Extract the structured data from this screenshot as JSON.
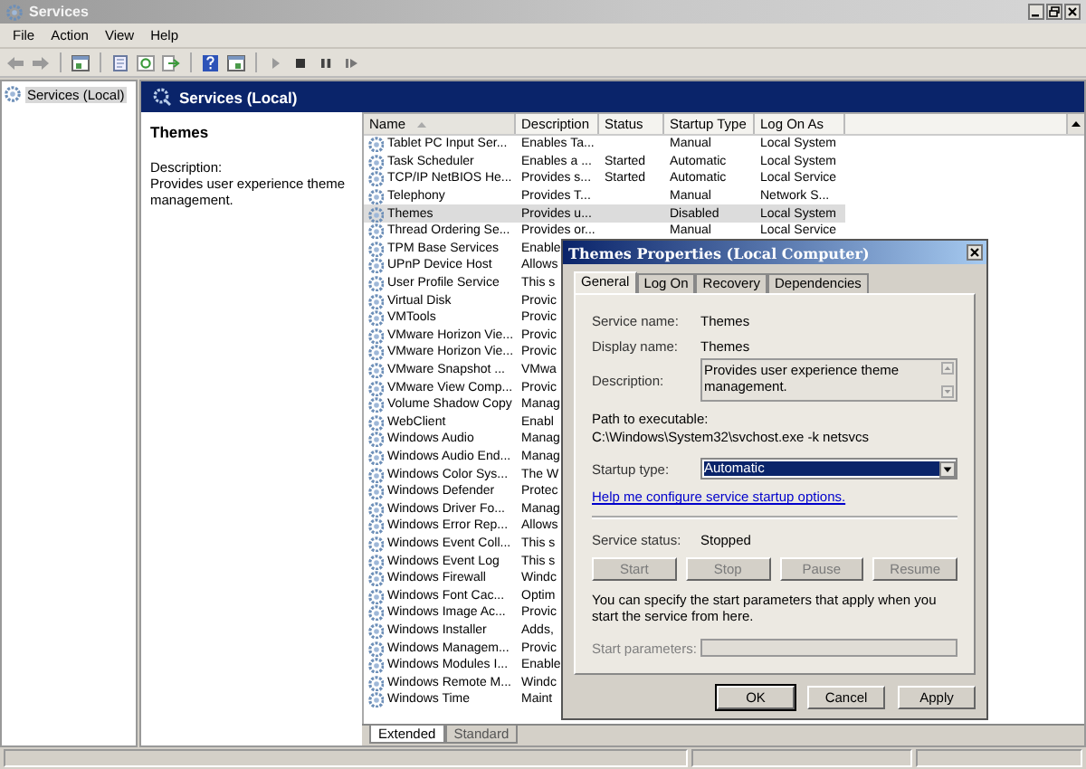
{
  "window": {
    "title": "Services"
  },
  "menu": [
    {
      "label": "File"
    },
    {
      "label": "Action"
    },
    {
      "label": "View"
    },
    {
      "label": "Help"
    }
  ],
  "tree": [
    {
      "label": "Services (Local)",
      "selected": true
    }
  ],
  "pane_header": "Services (Local)",
  "detail": {
    "title": "Themes",
    "description_label": "Description:",
    "description": "Provides user experience theme management."
  },
  "table": {
    "columns": [
      {
        "label": "Name",
        "sorted": true
      },
      {
        "label": "Description",
        "sorted": false
      },
      {
        "label": "Status",
        "sorted": false
      },
      {
        "label": "Startup Type",
        "sorted": false
      },
      {
        "label": "Log On As",
        "sorted": false
      }
    ],
    "rows": [
      {
        "cells": [
          "Tablet PC Input Ser...",
          "Enables Ta...",
          "",
          "Manual",
          "Local System"
        ],
        "selected": false
      },
      {
        "cells": [
          "Task Scheduler",
          "Enables a ...",
          "Started",
          "Automatic",
          "Local System"
        ],
        "selected": false
      },
      {
        "cells": [
          "TCP/IP NetBIOS He...",
          "Provides s...",
          "Started",
          "Automatic",
          "Local Service"
        ],
        "selected": false
      },
      {
        "cells": [
          "Telephony",
          "Provides T...",
          "",
          "Manual",
          "Network S..."
        ],
        "selected": false
      },
      {
        "cells": [
          "Themes",
          "Provides u...",
          "",
          "Disabled",
          "Local System"
        ],
        "selected": true
      },
      {
        "cells": [
          "Thread Ordering Se...",
          "Provides or...",
          "",
          "Manual",
          "Local Service"
        ],
        "selected": false
      },
      {
        "cells": [
          "TPM Base Services",
          "Enable"
        ],
        "selected": false
      },
      {
        "cells": [
          "UPnP Device Host",
          "Allows"
        ],
        "selected": false
      },
      {
        "cells": [
          "User Profile Service",
          "This s"
        ],
        "selected": false
      },
      {
        "cells": [
          "Virtual Disk",
          "Provic"
        ],
        "selected": false
      },
      {
        "cells": [
          "VMTools",
          "Provic"
        ],
        "selected": false
      },
      {
        "cells": [
          "VMware Horizon Vie...",
          "Provic"
        ],
        "selected": false
      },
      {
        "cells": [
          "VMware Horizon Vie...",
          "Provic"
        ],
        "selected": false
      },
      {
        "cells": [
          "VMware Snapshot ...",
          "VMwa"
        ],
        "selected": false
      },
      {
        "cells": [
          "VMware View Comp...",
          "Provic"
        ],
        "selected": false
      },
      {
        "cells": [
          "Volume Shadow Copy",
          "Manag"
        ],
        "selected": false
      },
      {
        "cells": [
          "WebClient",
          "Enabl"
        ],
        "selected": false
      },
      {
        "cells": [
          "Windows Audio",
          "Manag"
        ],
        "selected": false
      },
      {
        "cells": [
          "Windows Audio End...",
          "Manag"
        ],
        "selected": false
      },
      {
        "cells": [
          "Windows Color Sys...",
          "The W"
        ],
        "selected": false
      },
      {
        "cells": [
          "Windows Defender",
          "Protec"
        ],
        "selected": false
      },
      {
        "cells": [
          "Windows Driver Fo...",
          "Manag"
        ],
        "selected": false
      },
      {
        "cells": [
          "Windows Error Rep...",
          "Allows"
        ],
        "selected": false
      },
      {
        "cells": [
          "Windows Event Coll...",
          "This s"
        ],
        "selected": false
      },
      {
        "cells": [
          "Windows Event Log",
          "This s"
        ],
        "selected": false
      },
      {
        "cells": [
          "Windows Firewall",
          "Windc"
        ],
        "selected": false
      },
      {
        "cells": [
          "Windows Font Cac...",
          "Optim"
        ],
        "selected": false
      },
      {
        "cells": [
          "Windows Image Ac...",
          "Provic"
        ],
        "selected": false
      },
      {
        "cells": [
          "Windows Installer",
          "Adds,"
        ],
        "selected": false
      },
      {
        "cells": [
          "Windows Managem...",
          "Provic"
        ],
        "selected": false
      },
      {
        "cells": [
          "Windows Modules I...",
          "Enable"
        ],
        "selected": false
      },
      {
        "cells": [
          "Windows Remote M...",
          "Windc"
        ],
        "selected": false
      },
      {
        "cells": [
          "Windows Time",
          "Maint"
        ],
        "selected": false
      }
    ]
  },
  "view_tabs": [
    {
      "label": "Extended",
      "selected": true
    },
    {
      "label": "Standard",
      "selected": false
    }
  ],
  "dialog": {
    "title": "Themes Properties (Local Computer)",
    "tabs": [
      {
        "label": "General",
        "selected": true
      },
      {
        "label": "Log On",
        "selected": false
      },
      {
        "label": "Recovery",
        "selected": false
      },
      {
        "label": "Dependencies",
        "selected": false
      }
    ],
    "service_name_label": "Service name:",
    "service_name": "Themes",
    "display_name_label": "Display name:",
    "display_name": "Themes",
    "description_label": "Description:",
    "description": "Provides user experience theme management.",
    "path_label": "Path to executable:",
    "path": "C:\\Windows\\System32\\svchost.exe -k netsvcs",
    "startup_label": "Startup type:",
    "startup_value": "Automatic",
    "help_link": "Help me configure service startup options.",
    "status_label": "Service status:",
    "status_value": "Stopped",
    "control_buttons": [
      {
        "label": "Start",
        "disabled": true
      },
      {
        "label": "Stop",
        "disabled": true
      },
      {
        "label": "Pause",
        "disabled": true
      },
      {
        "label": "Resume",
        "disabled": true
      }
    ],
    "note": "You can specify the start parameters that apply when you start the service from here.",
    "params_label": "Start parameters:",
    "params_disabled": true,
    "buttons": [
      {
        "label": "OK",
        "default": true
      },
      {
        "label": "Cancel",
        "default": false
      },
      {
        "label": "Apply",
        "default": false
      }
    ]
  }
}
